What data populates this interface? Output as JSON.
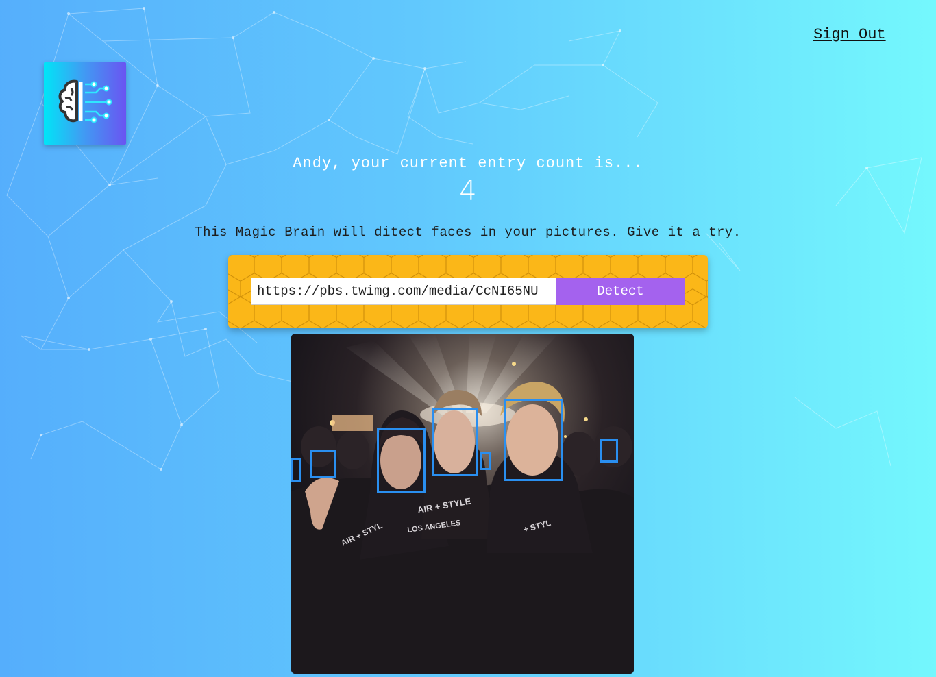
{
  "nav": {
    "signout_label": "Sign Out"
  },
  "logo": {
    "icon": "brain-circuit-icon"
  },
  "rank": {
    "message": "Andy, your current entry count is...",
    "count": "4"
  },
  "description": "This Magic Brain will ditect faces in your pictures. Give it a try.",
  "form": {
    "url_value": "https://pbs.twimg.com/media/CcNI65NU",
    "button_label": "Detect"
  },
  "image": {
    "printed_text": [
      "AIR + STYLE",
      "LOS ANGELES"
    ],
    "faces_detected": 7
  },
  "colors": {
    "accent_button": "#a462ee",
    "form_background": "#fbb718",
    "face_box": "#2a8ff0",
    "logo_gradient": [
      "#00e5f7",
      "#6a54f2"
    ]
  }
}
